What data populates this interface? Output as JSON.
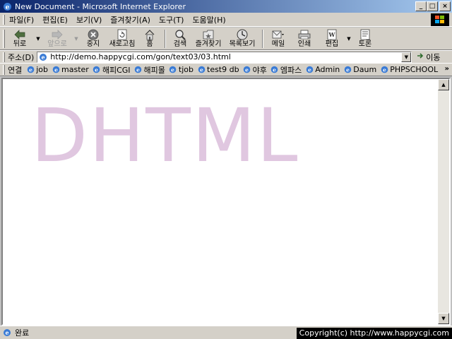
{
  "window": {
    "title": "New Document - Microsoft Internet Explorer",
    "buttons": {
      "minimize": "_",
      "maximize": "□",
      "close": "×"
    }
  },
  "menu": [
    "파일(F)",
    "편집(E)",
    "보기(V)",
    "즐겨찾기(A)",
    "도구(T)",
    "도움말(H)"
  ],
  "toolbar": {
    "back": "뒤로",
    "forward": "앞으로",
    "stop": "중지",
    "refresh": "새로고침",
    "home": "홈",
    "search": "검색",
    "favorites": "즐겨찾기",
    "history": "목록보기",
    "mail": "메일",
    "print": "인쇄",
    "edit": "편집",
    "discuss": "토론"
  },
  "address": {
    "label": "주소(D)",
    "url": "http://demo.happycgi.com/gon/text03/03.html",
    "go": "이동"
  },
  "links": {
    "label": "연결",
    "items": [
      "job",
      "master",
      "해피CGI",
      "해피몰",
      "tjob",
      "test9 db",
      "야후",
      "엠파스",
      "Admin",
      "Daum",
      "PHPSCHOOL"
    ],
    "more": "»"
  },
  "page": {
    "heading": "DHTML",
    "heading_color": "#e0c7e0"
  },
  "status": {
    "text": "완료",
    "copyright": "Copyright(c) http://www.happycgi.com"
  }
}
